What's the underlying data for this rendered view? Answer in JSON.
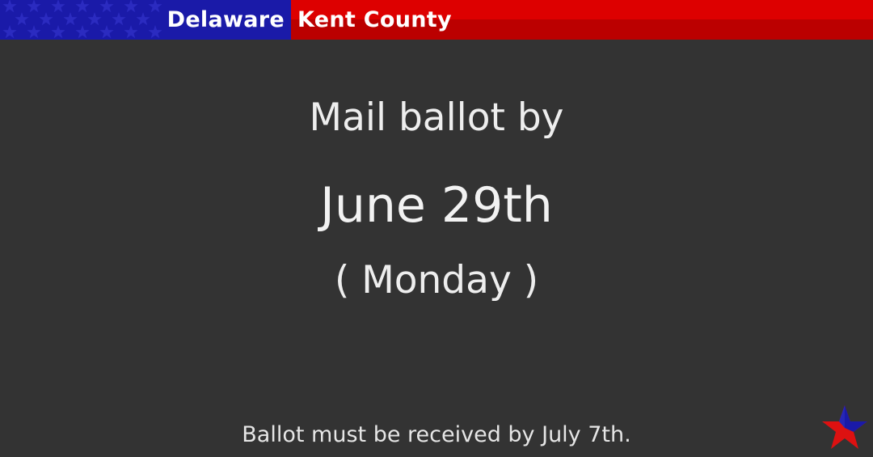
{
  "header": {
    "state": "Delaware",
    "county": "Kent County"
  },
  "colors": {
    "background": "#333333",
    "blue": "#1a1aa8",
    "red": "#dd0000",
    "text": "#eeeeee"
  },
  "main": {
    "headline": "Mail ballot by",
    "date": "June 29th",
    "weekday": "( Monday )"
  },
  "footer": {
    "note": "Ballot must be received by July 7th."
  },
  "icons": {
    "logo": "star-icon"
  }
}
